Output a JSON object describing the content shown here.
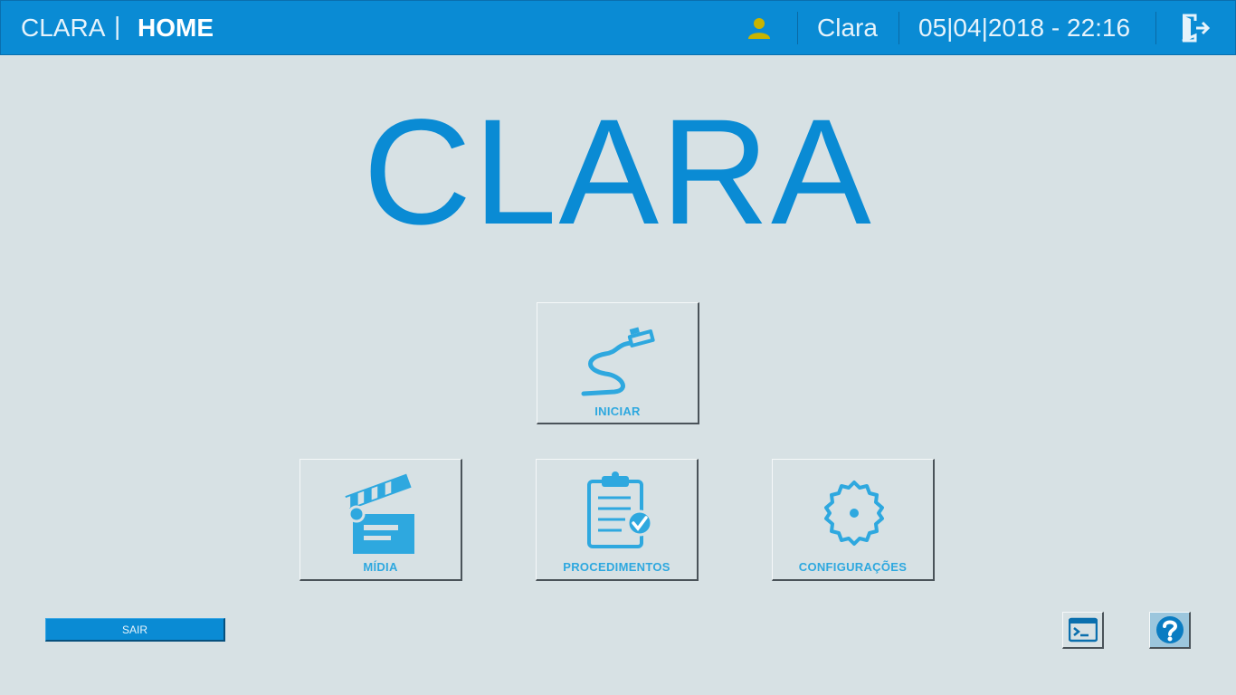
{
  "header": {
    "app_name": "CLARA",
    "separator": "|",
    "page_title": "HOME",
    "user_name": "Clara",
    "datetime": "05|04|2018 - 22:16",
    "icons": {
      "user": "user-icon",
      "logout": "logout-icon"
    },
    "colors": {
      "background": "#0a8bd4",
      "user_icon": "#c8b400"
    }
  },
  "hero": {
    "title": "CLARA",
    "color": "#0a8bd4"
  },
  "tiles": [
    {
      "label": "INICIAR",
      "icon": "endoscope-icon"
    },
    {
      "label": "MÍDIA",
      "icon": "clapperboard-icon"
    },
    {
      "label": "PROCEDIMENTOS",
      "icon": "clipboard-check-icon"
    },
    {
      "label": "CONFIGURAÇÕES",
      "icon": "gear-icon"
    }
  ],
  "footer": {
    "exit_label": "SAIR",
    "icons": {
      "terminal": "terminal-icon",
      "help": "help-icon"
    }
  }
}
